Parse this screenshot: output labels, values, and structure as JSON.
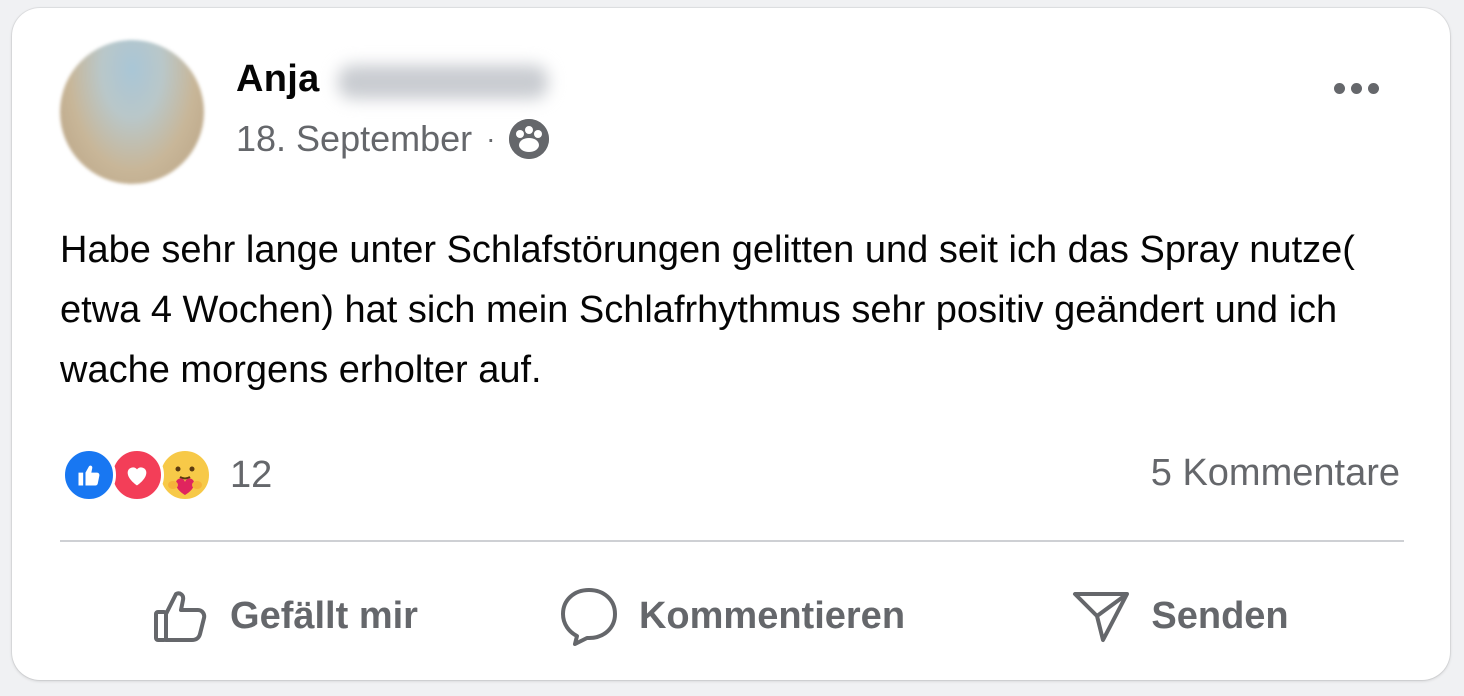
{
  "post": {
    "author_first_name": "Anja",
    "date": "18. September",
    "separator": "·",
    "audience_icon": "group-icon",
    "more_icon": "more-options-icon",
    "text": "Habe sehr lange unter Schlafstörungen gelitten und seit ich das Spray nutze( etwa 4 Wochen) hat sich mein Schlafrhythmus sehr positiv geändert und ich wache morgens erholter auf."
  },
  "reactions": {
    "types": [
      "like",
      "love",
      "care"
    ],
    "count": "12",
    "colors": {
      "like": "#1877f2",
      "love": "#f33e58",
      "care": "#f7c948"
    }
  },
  "comments": {
    "label": "5 Kommentare"
  },
  "actions": {
    "like_label": "Gefällt mir",
    "comment_label": "Kommentieren",
    "send_label": "Senden"
  },
  "colors": {
    "text_primary": "#050505",
    "text_secondary": "#65676b",
    "divider": "#ced0d4",
    "card_background": "#ffffff"
  }
}
